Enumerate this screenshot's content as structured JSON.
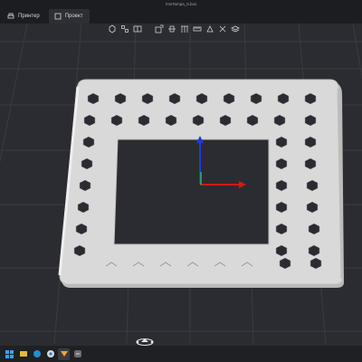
{
  "window": {
    "title": "rmsTampa_5.box"
  },
  "tabs": [
    {
      "label": "Принтер",
      "icon": "printer-icon",
      "active": false
    },
    {
      "label": "Проект",
      "icon": "project-icon",
      "active": true
    }
  ],
  "toolbar": {
    "icons": [
      "add-box-icon",
      "arrange-icon",
      "split-icon",
      "scale-icon",
      "cut-icon",
      "support-icon",
      "measure-icon",
      "paint-icon",
      "seam-icon",
      "layers-icon"
    ]
  },
  "viewport": {
    "background": "#2b2c32",
    "grid_color": "#3a3b42",
    "model_color": "#dcdcdc",
    "axes": {
      "x_color": "#d11a1a",
      "y_color": "#1a3be0",
      "z_color": "#20c060"
    }
  },
  "taskbar": {
    "apps": [
      "windows-start-icon",
      "explorer-icon",
      "edge-icon",
      "chrome-icon",
      "slicer-icon",
      "app-icon"
    ]
  }
}
